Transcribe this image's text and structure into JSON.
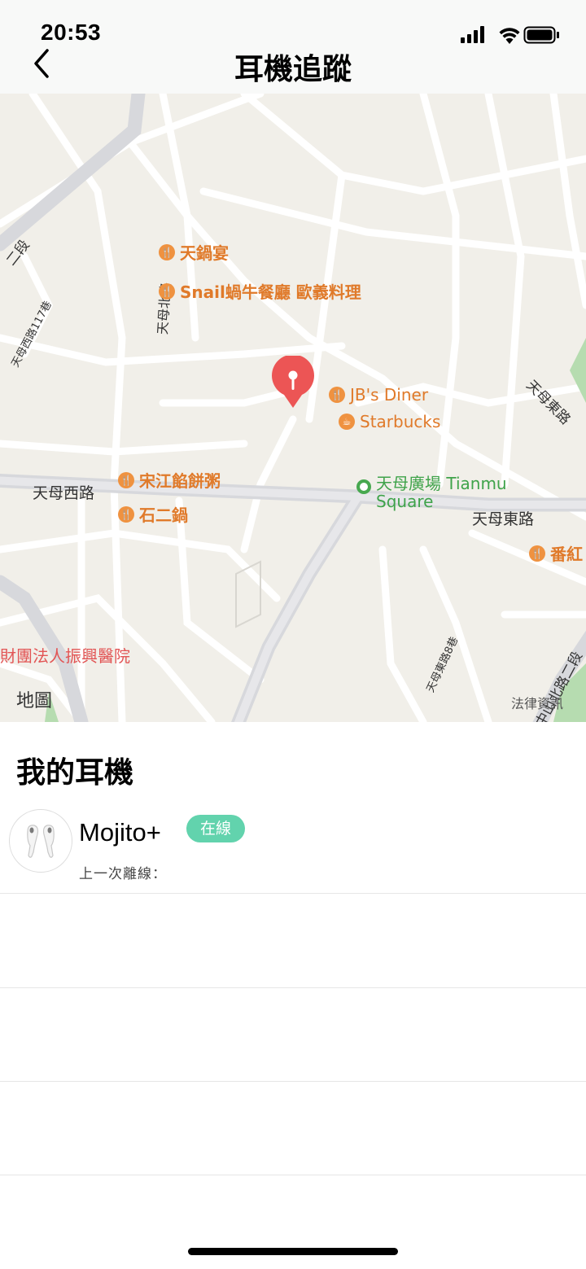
{
  "status_bar": {
    "time": "20:53"
  },
  "nav": {
    "title": "耳機追蹤"
  },
  "map": {
    "logo_text": "地圖",
    "legal_text": "法律資訊",
    "streets": [
      "天母西路",
      "天母東路",
      "天母北路",
      "天母西路117巷",
      "天母東路8巷",
      "天母東路",
      "二段",
      "中山北路二段"
    ],
    "pois": [
      {
        "name": "天鍋宴",
        "type": "restaurant"
      },
      {
        "name": "Snail蝸牛餐廳 歐義料理",
        "type": "restaurant"
      },
      {
        "name": "JB's Diner",
        "type": "restaurant"
      },
      {
        "name": "Starbucks",
        "type": "cafe"
      },
      {
        "name": "宋江餡餅粥",
        "type": "restaurant"
      },
      {
        "name": "石二鍋",
        "type": "restaurant"
      },
      {
        "name": "天母廣場 Tianmu",
        "name2": "Square",
        "type": "park"
      },
      {
        "name": "番紅",
        "type": "restaurant"
      },
      {
        "name": "財團法人振興醫院",
        "type": "hospital"
      }
    ],
    "pin_icon": "earbud-location-pin-icon"
  },
  "section": {
    "title": "我的耳機"
  },
  "devices": [
    {
      "name": "Mojito+",
      "status": "在線",
      "last_offline_label": "上一次離線：",
      "icon": "earbuds-icon"
    }
  ],
  "colors": {
    "badge": "#62d3ad",
    "pin": "#ec5555",
    "map_bg": "#f1efe9"
  }
}
